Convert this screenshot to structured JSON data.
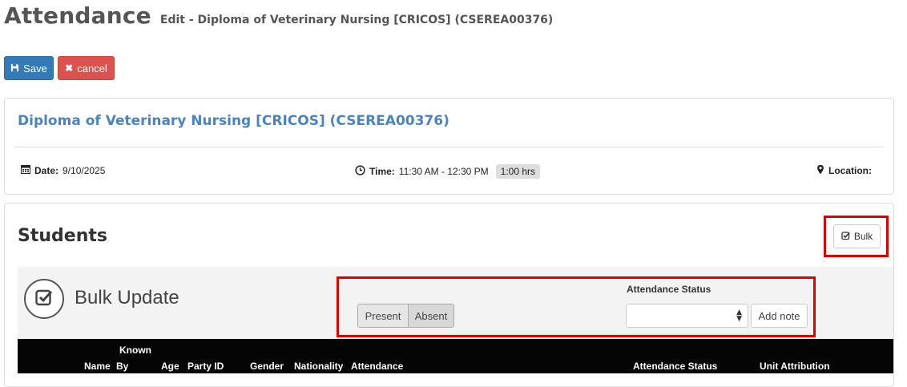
{
  "header": {
    "title": "Attendance",
    "subtitle": "Edit - Diploma of Veterinary Nursing [CRICOS] (CSEREA00376)"
  },
  "toolbar": {
    "save_label": "Save",
    "cancel_label": "cancel"
  },
  "session": {
    "course_title": "Diploma of Veterinary Nursing [CRICOS] (CSEREA00376)",
    "date_label": "Date:",
    "date_value": "9/10/2025",
    "time_label": "Time:",
    "time_value": "11:30 AM - 12:30 PM",
    "duration": "1:00 hrs",
    "location_label": "Location:",
    "location_value": ""
  },
  "students": {
    "title": "Students",
    "bulk_button_label": "Bulk"
  },
  "bulk_update": {
    "title": "Bulk Update",
    "present_label": "Present",
    "absent_label": "Absent",
    "attendance_status_label": "Attendance Status",
    "attendance_status_value": "",
    "add_note_label": "Add note"
  },
  "table": {
    "columns": [
      "Name",
      "Known By",
      "Age",
      "Party ID",
      "Gender",
      "Nationality",
      "Attendance",
      "Attendance Status",
      "Unit Attribution"
    ],
    "known_by_line1": "Known",
    "known_by_line2": "By"
  },
  "colors": {
    "primary": "#337ab7",
    "danger": "#d9534f",
    "link": "#4a84bf",
    "highlight": "#e00000",
    "table_header_bg": "#050505"
  }
}
